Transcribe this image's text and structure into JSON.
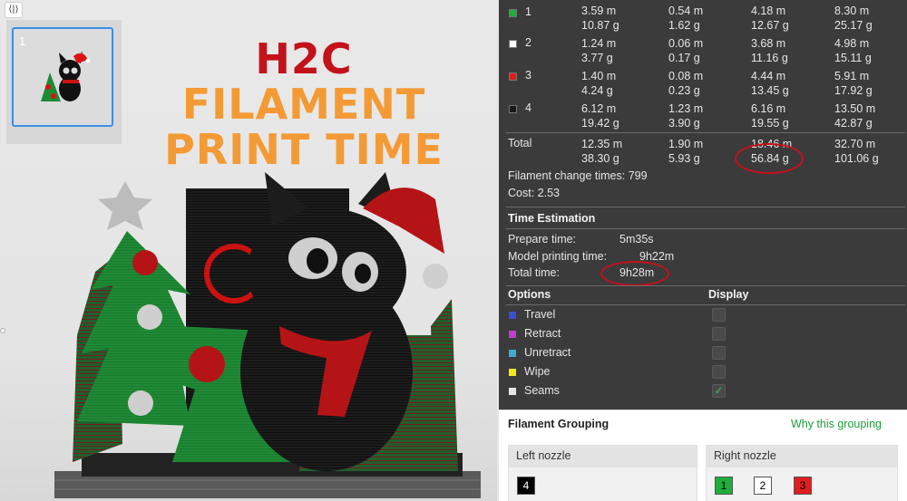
{
  "viewport": {
    "toggle_icon": "code-toggle-icon",
    "toggle_glyph": "⟨|⟩",
    "plate_number": "1",
    "headline_line1_red": "H2C",
    "headline_line1_orange": "FILAMENT",
    "headline_line2": "PRINT TIME"
  },
  "filaments": [
    {
      "index": "1",
      "color": "#1fae3b",
      "c1": [
        "3.59 m",
        "10.87 g"
      ],
      "c2": [
        "0.54 m",
        "1.62 g"
      ],
      "c3": [
        "4.18 m",
        "12.67 g"
      ],
      "c4": [
        "8.30 m",
        "25.17 g"
      ]
    },
    {
      "index": "2",
      "color": "#ffffff",
      "c1": [
        "1.24 m",
        "3.77 g"
      ],
      "c2": [
        "0.06 m",
        "0.17 g"
      ],
      "c3": [
        "3.68 m",
        "11.16 g"
      ],
      "c4": [
        "4.98 m",
        "15.11 g"
      ]
    },
    {
      "index": "3",
      "color": "#e01e1e",
      "c1": [
        "1.40 m",
        "4.24 g"
      ],
      "c2": [
        "0.08 m",
        "0.23 g"
      ],
      "c3": [
        "4.44 m",
        "13.45 g"
      ],
      "c4": [
        "5.91 m",
        "17.92 g"
      ]
    },
    {
      "index": "4",
      "color": "#1a1a1a",
      "c1": [
        "6.12 m",
        "19.42 g"
      ],
      "c2": [
        "1.23 m",
        "3.90 g"
      ],
      "c3": [
        "6.16 m",
        "19.55 g"
      ],
      "c4": [
        "13.50 m",
        "42.87 g"
      ]
    }
  ],
  "total": {
    "label": "Total",
    "c1": [
      "12.35 m",
      "38.30 g"
    ],
    "c2": [
      "1.90 m",
      "5.93 g"
    ],
    "c3": [
      "18.46 m",
      "56.84 g"
    ],
    "c4": [
      "32.70 m",
      "101.06 g"
    ]
  },
  "filament_change": {
    "label": "Filament change times:",
    "value": "799"
  },
  "cost": {
    "label": "Cost:",
    "value": "2.53"
  },
  "time_estimation": {
    "title": "Time Estimation",
    "prepare_label": "Prepare time:",
    "prepare_value": "5m35s",
    "model_label": "Model printing time:",
    "model_value": "9h22m",
    "total_label": "Total time:",
    "total_value": "9h28m"
  },
  "options": {
    "title_options": "Options",
    "title_display": "Display",
    "items": [
      {
        "label": "Travel",
        "color": "#3a4fd1",
        "checked": false
      },
      {
        "label": "Retract",
        "color": "#c23ccf",
        "checked": false
      },
      {
        "label": "Unretract",
        "color": "#3fa9d8",
        "checked": false
      },
      {
        "label": "Wipe",
        "color": "#f2e81a",
        "checked": false
      },
      {
        "label": "Seams",
        "color": "#e6e6e6",
        "checked": true
      }
    ],
    "check_glyph": "✓"
  },
  "grouping": {
    "title": "Filament Grouping",
    "why": "Why this grouping",
    "left_nozzle": {
      "label": "Left nozzle",
      "chips": [
        {
          "text": "4",
          "bg": "#000000",
          "fg": "#ffffff"
        }
      ]
    },
    "right_nozzle": {
      "label": "Right nozzle",
      "chips": [
        {
          "text": "1",
          "bg": "#1fae3b",
          "fg": "#000000"
        },
        {
          "text": "2",
          "bg": "#ffffff",
          "fg": "#000000"
        },
        {
          "text": "3",
          "bg": "#e01e1e",
          "fg": "#000000"
        }
      ]
    }
  }
}
